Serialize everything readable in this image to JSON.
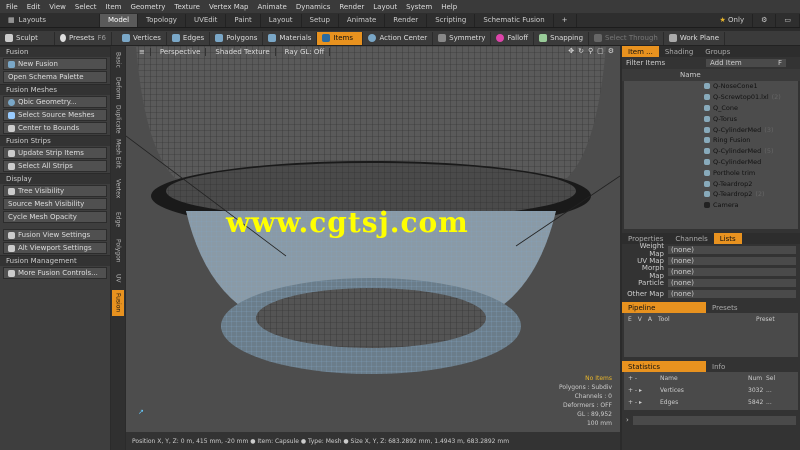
{
  "menu": [
    "File",
    "Edit",
    "View",
    "Select",
    "Item",
    "Geometry",
    "Texture",
    "Vertex Map",
    "Animate",
    "Dynamics",
    "Render",
    "Layout",
    "System",
    "Help"
  ],
  "layouts_label": "Layouts",
  "tabs": [
    "Model",
    "Topology",
    "UVEdit",
    "Paint",
    "Layout",
    "Setup",
    "Animate",
    "Render",
    "Scripting",
    "Schematic Fusion"
  ],
  "only_label": "Only",
  "toolbar": {
    "sculpt": "Sculpt",
    "presets": "Presets",
    "presets_key": "F6",
    "vertices": "Vertices",
    "edges": "Edges",
    "polygons": "Polygons",
    "materials": "Materials",
    "items": "Items",
    "action_center": "Action Center",
    "symmetry": "Symmetry",
    "falloff": "Falloff",
    "snapping": "Snapping",
    "select_through": "Select Through",
    "work_plane": "Work Plane"
  },
  "left": {
    "s1": "Fusion",
    "new_fusion": "New Fusion",
    "open_schema": "Open Schema Palette",
    "s2": "Fusion Meshes",
    "qbic": "Qbic Geometry...",
    "select_source": "Select Source Meshes",
    "center": "Center to Bounds",
    "s3": "Fusion Strips",
    "update_strip": "Update Strip Items",
    "select_strips": "Select All Strips",
    "s4": "Display",
    "tree_vis": "Tree Visibility",
    "source_vis": "Source Mesh Visibility",
    "cycle_opacity": "Cycle Mesh Opacity",
    "view_settings": "Fusion View Settings",
    "alt_viewport": "Alt Viewport Settings",
    "s5": "Fusion Management",
    "more_controls": "More Fusion Controls..."
  },
  "vtabs": [
    "Basic",
    "Deform",
    "Duplicate",
    "Mesh Edit",
    "Vertex",
    "Edge",
    "Polygon",
    "UV",
    "Fusion"
  ],
  "viewport": {
    "perspective": "Perspective",
    "shading": "Shaded Texture",
    "raygl": "Ray GL: Off",
    "no_items": "No Items",
    "polygons": "Polygons : Subdiv",
    "channels": "Channels : 0",
    "deformers": "Deformers : OFF",
    "gl": "GL : 89,952",
    "scale": "100 mm"
  },
  "watermark": "www.cgtsj.com",
  "status": "Position X, Y, Z:  0 m, 415 mm, -20 mm  ● Item: Capsule ● Type: Mesh ● Size X, Y, Z:  683.2892 mm, 1.4943 m, 683.2892 mm",
  "right": {
    "tabs": [
      "Item ...",
      "Shading",
      "Groups"
    ],
    "filter": "Filter Items",
    "add_item": "Add Item",
    "add_item_key": "F",
    "name_col": "Name",
    "items": [
      {
        "name": "Q-NoseCone1",
        "suffix": ""
      },
      {
        "name": "Q-Screwtop01.lxl",
        "suffix": "(2)"
      },
      {
        "name": "Q_Cone",
        "suffix": ""
      },
      {
        "name": "Q-Torus",
        "suffix": ""
      },
      {
        "name": "Q-CylinderMed",
        "suffix": "(3)"
      },
      {
        "name": "Ring Fusion",
        "suffix": ""
      },
      {
        "name": "Q-CylinderMed",
        "suffix": "(5)"
      },
      {
        "name": "Q-CylinderMed",
        "suffix": ""
      },
      {
        "name": "Porthole trim",
        "suffix": ""
      },
      {
        "name": "Q-Teardrop2",
        "suffix": ""
      },
      {
        "name": "Q-Teardrop2",
        "suffix": "(2)"
      },
      {
        "name": "Camera",
        "suffix": ""
      }
    ],
    "ptabs": [
      "Properties",
      "Channels",
      "Lists"
    ],
    "props": [
      {
        "k": "Weight Map",
        "v": "(none)"
      },
      {
        "k": "UV Map",
        "v": "(none)"
      },
      {
        "k": "Morph Map",
        "v": "(none)"
      },
      {
        "k": "Particle",
        "v": "(none)"
      },
      {
        "k": "Other Map",
        "v": "(none)"
      }
    ],
    "pipeline": "Pipeline",
    "presets": "Presets",
    "tool_col": "Tool",
    "preset_col": "Preset",
    "statistics": "Statistics",
    "info": "Info",
    "stat_name": "Name",
    "stat_num": "Num",
    "stat_sel": "Sel",
    "stats": [
      {
        "name": "Vertices",
        "num": "3032",
        "sel": "..."
      },
      {
        "name": "Edges",
        "num": "5842",
        "sel": "..."
      }
    ]
  }
}
